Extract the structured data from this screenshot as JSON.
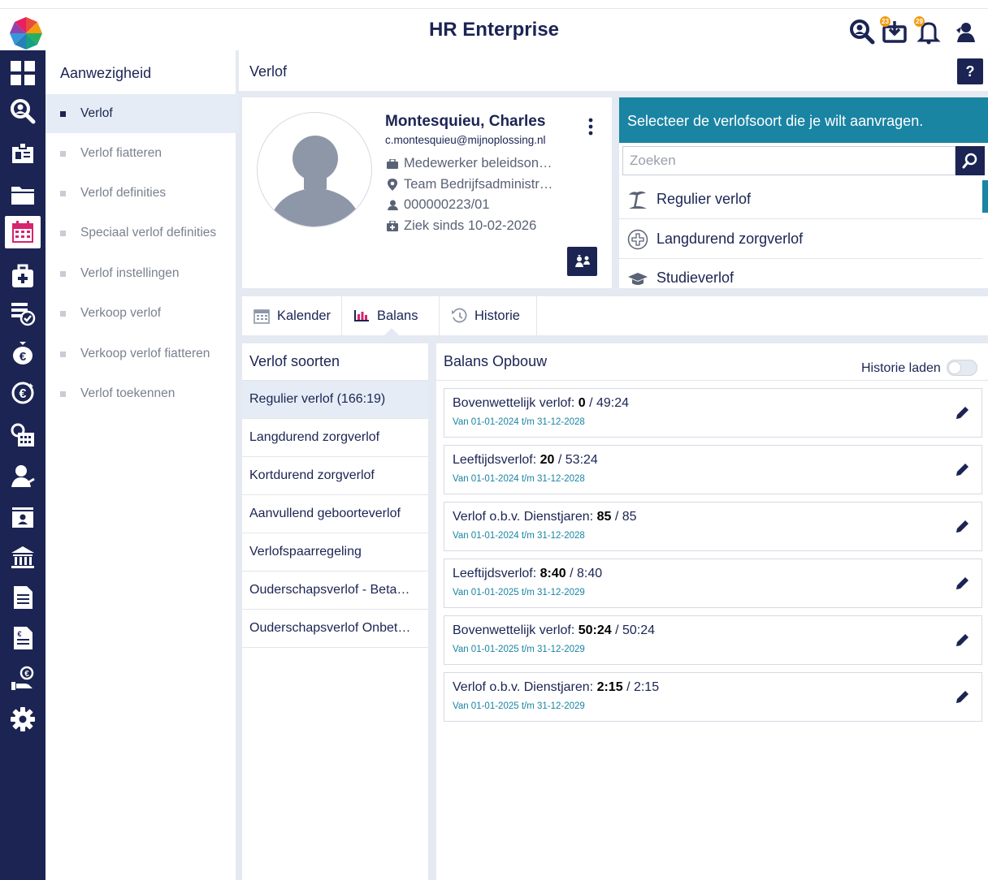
{
  "header": {
    "title": "HR Enterprise",
    "badges": {
      "downloads": "23",
      "notifications": "29"
    }
  },
  "rail": {
    "items": [
      "dashboard-icon",
      "search-person-icon",
      "employee-card-icon",
      "folder-icon",
      "calendar-icon",
      "medical-case-icon",
      "checklist-icon",
      "money-bag-icon",
      "euro-cycle-icon",
      "clock-calendar-icon",
      "person-sign-icon",
      "id-card-icon",
      "bank-icon",
      "document-icon",
      "euro-document-icon",
      "hand-coin-icon",
      "gear-icon"
    ],
    "active_index": 4
  },
  "section_nav": {
    "title": "Aanwezigheid",
    "items": [
      {
        "label": "Verlof",
        "active": true
      },
      {
        "label": "Verlof fiatteren"
      },
      {
        "label": "Verlof definities"
      },
      {
        "label": "Speciaal verlof definities"
      },
      {
        "label": "Verlof instellingen"
      },
      {
        "label": "Verkoop verlof"
      },
      {
        "label": "Verkoop verlof fiatteren"
      },
      {
        "label": "Verlof toekennen"
      }
    ]
  },
  "content": {
    "title": "Verlof",
    "help_label": "?"
  },
  "employee": {
    "name": "Montesquieu, Charles",
    "email": "c.montesquieu@mijnoplossing.nl",
    "function": "Medewerker beleidson…",
    "team": "Team Bedrijfsadministr…",
    "number": "000000223/01",
    "sick": "Ziek sinds 10-02-2026"
  },
  "leave_type": {
    "header": "Selecteer de verlofsoort die je wilt aanvragen.",
    "search_placeholder": "Zoeken",
    "items": [
      {
        "label": "Regulier verlof",
        "icon": "beach-icon"
      },
      {
        "label": "Langdurend zorgverlof",
        "icon": "plus-circle-icon"
      },
      {
        "label": "Studieverlof",
        "icon": "graduation-cap-icon"
      }
    ]
  },
  "tabs": [
    {
      "label": "Kalender",
      "icon": "calendar-icon"
    },
    {
      "label": "Balans",
      "icon": "bar-chart-icon",
      "active": true
    },
    {
      "label": "Historie",
      "icon": "history-icon"
    }
  ],
  "leave_kinds": {
    "title": "Verlof soorten",
    "items": [
      {
        "label": "Regulier verlof (166:19)",
        "active": true
      },
      {
        "label": "Langdurend zorgverlof"
      },
      {
        "label": "Kortdurend zorgverlof"
      },
      {
        "label": "Aanvullend geboorteverlof"
      },
      {
        "label": "Verlofspaarregeling"
      },
      {
        "label": "Ouderschapsverlof - Beta…"
      },
      {
        "label": "Ouderschapsverlof Onbet…"
      }
    ]
  },
  "balance": {
    "title": "Balans Opbouw",
    "history_label": "Historie laden",
    "history_on": false,
    "items": [
      {
        "label": "Bovenwettelijk verlof:",
        "value": "0",
        "total": "/ 49:24",
        "period": "Van 01-01-2024 t/m 31-12-2028"
      },
      {
        "label": "Leeftijdsverlof:",
        "value": "20",
        "total": "/ 53:24",
        "period": "Van 01-01-2024 t/m 31-12-2028"
      },
      {
        "label": "Verlof o.b.v. Dienstjaren:",
        "value": "85",
        "total": "/ 85",
        "period": "Van 01-01-2024 t/m 31-12-2028"
      },
      {
        "label": "Leeftijdsverlof:",
        "value": "8:40",
        "total": "/ 8:40",
        "period": "Van 01-01-2025 t/m 31-12-2029"
      },
      {
        "label": "Bovenwettelijk verlof:",
        "value": "50:24",
        "total": "/ 50:24",
        "period": "Van 01-01-2025 t/m 31-12-2029"
      },
      {
        "label": "Verlof o.b.v. Dienstjaren:",
        "value": "2:15",
        "total": "/ 2:15",
        "period": "Van 01-01-2025 t/m 31-12-2029"
      }
    ]
  },
  "colors": {
    "navy": "#1b2453",
    "teal": "#1a84a3",
    "active_calendar": "#d6246e"
  }
}
